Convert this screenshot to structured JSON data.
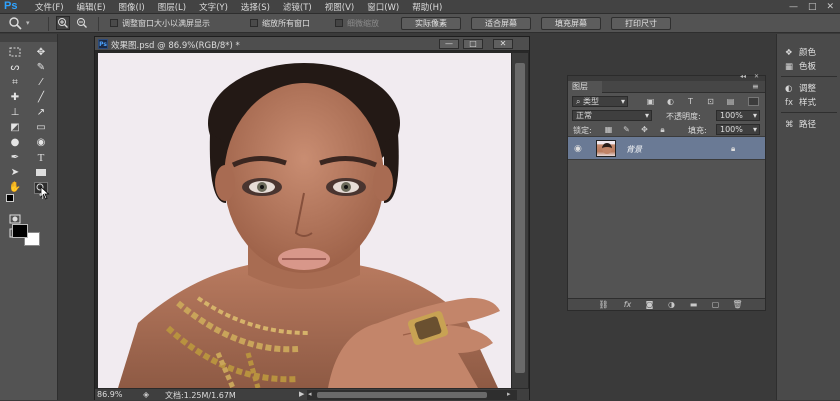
{
  "app": {
    "logo": "Ps",
    "menu": [
      "文件(F)",
      "编辑(E)",
      "图像(I)",
      "图层(L)",
      "文字(Y)",
      "选择(S)",
      "滤镜(T)",
      "视图(V)",
      "窗口(W)",
      "帮助(H)"
    ],
    "window_controls": [
      "—",
      "□",
      "✕"
    ]
  },
  "options_bar": {
    "checkbox1_label": "调整窗口大小以满屏显示",
    "checkbox2_label": "缩放所有窗口",
    "checkbox3_label": "细微缩放",
    "btn_actual_pixels": "实际像素",
    "btn_fit_screen": "适合屏幕",
    "btn_fill_screen": "填充屏幕",
    "btn_print_size": "打印尺寸"
  },
  "document": {
    "title": "效果图.psd @ 86.9%(RGB/8*) *",
    "icon_text": "Ps",
    "controls": [
      "—",
      "□",
      "✕"
    ],
    "zoom": "86.9%",
    "info": "文档:1.25M/1.67M"
  },
  "layers_panel": {
    "tab": "图层",
    "filter_kind": "类型",
    "blend_mode": "正常",
    "opacity_label": "不透明度:",
    "opacity_value": "100%",
    "lock_label": "锁定:",
    "fill_label": "填充:",
    "fill_value": "100%",
    "layer_name": "背景"
  },
  "dock": {
    "items": [
      "颜色",
      "色板",
      "调整",
      "样式",
      "路径"
    ]
  },
  "colors": {
    "accent": "#2fa3ff",
    "selected_layer": "#6a7a95",
    "foreground": "#000000",
    "background": "#ffffff"
  }
}
